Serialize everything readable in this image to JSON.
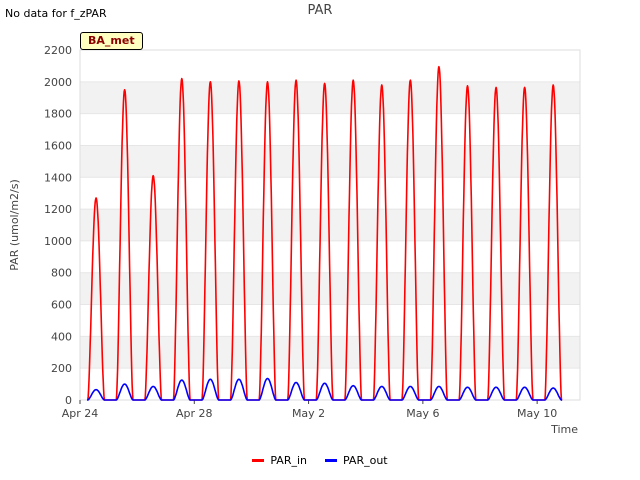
{
  "notice": "No data for f_zPAR",
  "site_tag": "BA_met",
  "colors": {
    "PAR_in": "#ff0000",
    "PAR_out": "#0000ff",
    "band": "#f2f2f2"
  },
  "chart_data": {
    "type": "line",
    "title": "PAR",
    "xlabel": "Time",
    "ylabel": "PAR (umol/m2/s)",
    "ylim": [
      0,
      2200
    ],
    "yticks": [
      0,
      200,
      400,
      600,
      800,
      1000,
      1200,
      1400,
      1600,
      1800,
      2000,
      2200
    ],
    "xlim": [
      "2024-04-24",
      "2024-05-11 12:00"
    ],
    "xticks": [
      "Apr 24",
      "Apr 28",
      "May 2",
      "May 6",
      "May 10"
    ],
    "grid": "alternating horizontal bands",
    "legend_position": "bottom",
    "series": [
      {
        "name": "PAR_in",
        "daily_peaks": [
          {
            "date": "2024-04-24",
            "peak": 1270
          },
          {
            "date": "2024-04-25",
            "peak": 1950
          },
          {
            "date": "2024-04-26",
            "peak": 1410
          },
          {
            "date": "2024-04-27",
            "peak": 2020
          },
          {
            "date": "2024-04-28",
            "peak": 2000
          },
          {
            "date": "2024-04-29",
            "peak": 2005
          },
          {
            "date": "2024-04-30",
            "peak": 2000
          },
          {
            "date": "2024-05-01",
            "peak": 2010
          },
          {
            "date": "2024-05-02",
            "peak": 1990
          },
          {
            "date": "2024-05-03",
            "peak": 2010
          },
          {
            "date": "2024-05-04",
            "peak": 1980
          },
          {
            "date": "2024-05-05",
            "peak": 2010
          },
          {
            "date": "2024-05-06",
            "peak": 2095
          },
          {
            "date": "2024-05-07",
            "peak": 1975
          },
          {
            "date": "2024-05-08",
            "peak": 1965
          },
          {
            "date": "2024-05-09",
            "peak": 1965
          },
          {
            "date": "2024-05-10",
            "peak": 1980
          }
        ]
      },
      {
        "name": "PAR_out",
        "daily_peaks": [
          {
            "date": "2024-04-24",
            "peak": 65
          },
          {
            "date": "2024-04-25",
            "peak": 100
          },
          {
            "date": "2024-04-26",
            "peak": 85
          },
          {
            "date": "2024-04-27",
            "peak": 125
          },
          {
            "date": "2024-04-28",
            "peak": 130
          },
          {
            "date": "2024-04-29",
            "peak": 130
          },
          {
            "date": "2024-04-30",
            "peak": 135
          },
          {
            "date": "2024-05-01",
            "peak": 110
          },
          {
            "date": "2024-05-02",
            "peak": 105
          },
          {
            "date": "2024-05-03",
            "peak": 90
          },
          {
            "date": "2024-05-04",
            "peak": 85
          },
          {
            "date": "2024-05-05",
            "peak": 85
          },
          {
            "date": "2024-05-06",
            "peak": 85
          },
          {
            "date": "2024-05-07",
            "peak": 80
          },
          {
            "date": "2024-05-08",
            "peak": 80
          },
          {
            "date": "2024-05-09",
            "peak": 80
          },
          {
            "date": "2024-05-10",
            "peak": 75
          }
        ]
      }
    ]
  }
}
